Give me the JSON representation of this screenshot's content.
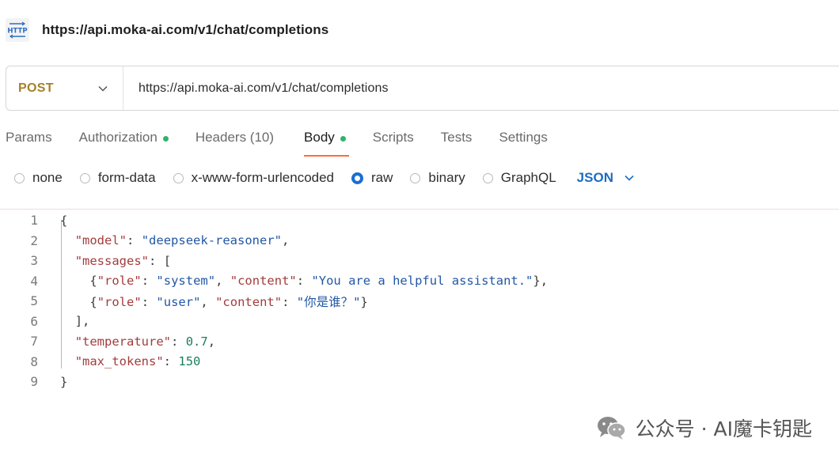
{
  "request": {
    "icon_name": "http-icon",
    "icon_text": "HTTP",
    "title": "https://api.moka-ai.com/v1/chat/completions"
  },
  "url_bar": {
    "method": "POST",
    "url": "https://api.moka-ai.com/v1/chat/completions"
  },
  "tabs": [
    {
      "label": "Params",
      "dot": false,
      "active": false
    },
    {
      "label": "Authorization",
      "dot": true,
      "active": false
    },
    {
      "label": "Headers (10)",
      "dot": false,
      "active": false
    },
    {
      "label": "Body",
      "dot": true,
      "active": true
    },
    {
      "label": "Scripts",
      "dot": false,
      "active": false
    },
    {
      "label": "Tests",
      "dot": false,
      "active": false
    },
    {
      "label": "Settings",
      "dot": false,
      "active": false
    }
  ],
  "body_types": [
    {
      "label": "none",
      "selected": false
    },
    {
      "label": "form-data",
      "selected": false
    },
    {
      "label": "x-www-form-urlencoded",
      "selected": false
    },
    {
      "label": "raw",
      "selected": true
    },
    {
      "label": "binary",
      "selected": false
    },
    {
      "label": "GraphQL",
      "selected": false
    }
  ],
  "body_format": "JSON",
  "code_lines": [
    {
      "n": "1",
      "text": "{"
    },
    {
      "n": "2",
      "text": "  \"model\": \"deepseek-reasoner\","
    },
    {
      "n": "3",
      "text": "  \"messages\": ["
    },
    {
      "n": "4",
      "text": "    {\"role\": \"system\", \"content\": \"You are a helpful assistant.\"},"
    },
    {
      "n": "5",
      "text": "    {\"role\": \"user\", \"content\": \"你是谁？\"}"
    },
    {
      "n": "6",
      "text": "  ],"
    },
    {
      "n": "7",
      "text": "  \"temperature\": 0.7,"
    },
    {
      "n": "8",
      "text": "  \"max_tokens\": 150"
    },
    {
      "n": "9",
      "text": "}"
    }
  ],
  "watermark": {
    "icon_name": "wechat-icon",
    "text": "公众号 · AI魔卡钥匙"
  },
  "colors": {
    "method": "#a6812a",
    "active_tab_underline": "#ff6c37",
    "status_dot": "#2fb36c",
    "radio_selected": "#1a6fd0",
    "json_select": "#1e6dc0",
    "json_key": "#a33c3c",
    "json_string": "#2257a5",
    "json_number": "#1d7f5c"
  }
}
